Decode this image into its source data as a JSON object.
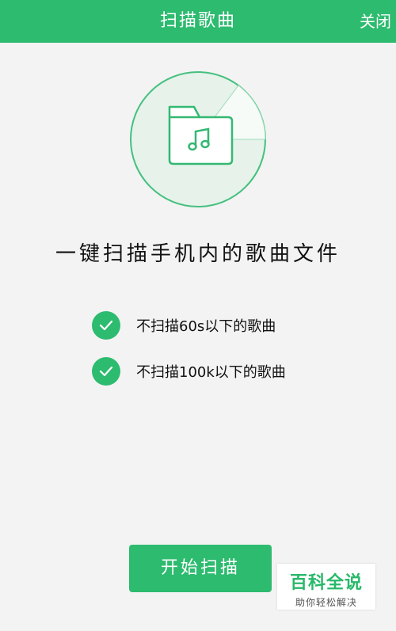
{
  "header": {
    "title": "扫描歌曲",
    "close_label": "关闭"
  },
  "illustration": {
    "icon": "music-folder-icon"
  },
  "headline": "一键扫描手机内的歌曲文件",
  "options": [
    {
      "label": "不扫描60s以下的歌曲",
      "checked": true
    },
    {
      "label": "不扫描100k以下的歌曲",
      "checked": true
    }
  ],
  "start_button_label": "开始扫描",
  "watermark": {
    "brand": "百科全说",
    "slogan": "助你轻松解决"
  },
  "colors": {
    "accent": "#2dbb6f",
    "background": "#f3f3f3"
  }
}
